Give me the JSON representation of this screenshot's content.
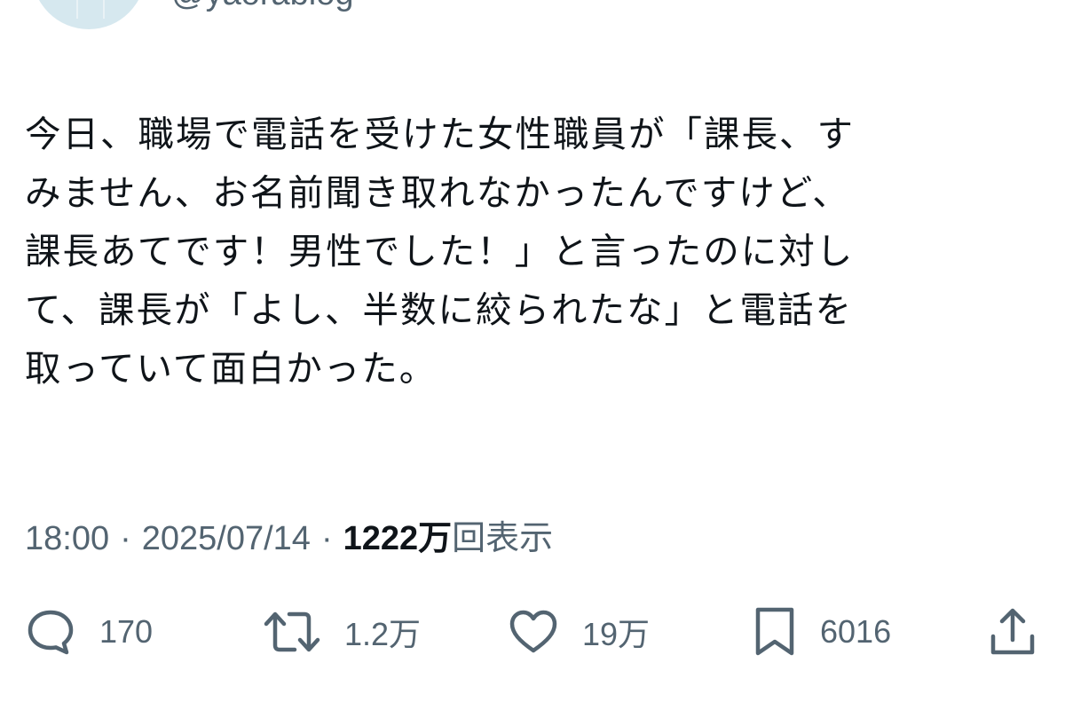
{
  "author": {
    "handle": "@yaorablog"
  },
  "tweet": {
    "lines": [
      "今日、職場で電話を受けた女性職員が「課長、す",
      "みません、お名前聞き取れなかったんですけど、",
      "課長あてです！男性でした！」と言ったのに対し",
      "て、課長が「よし、半数に絞られたな」と電話を",
      "取っていて面白かった。"
    ]
  },
  "meta": {
    "time": "18:00",
    "separator": "·",
    "date": "2025/07/14",
    "views_count": "1222万",
    "views_label": "回表示"
  },
  "actions": {
    "reply": {
      "icon": "reply-icon",
      "count": "170"
    },
    "retweet": {
      "icon": "retweet-icon",
      "count": "1.2万"
    },
    "like": {
      "icon": "heart-icon",
      "count": "19万"
    },
    "bookmark": {
      "icon": "bookmark-icon",
      "count": "6016"
    },
    "share": {
      "icon": "share-icon"
    }
  },
  "colors": {
    "text_primary": "#0f1419",
    "text_secondary": "#536471",
    "avatar_bg": "#d6e8ef",
    "background": "#ffffff"
  }
}
